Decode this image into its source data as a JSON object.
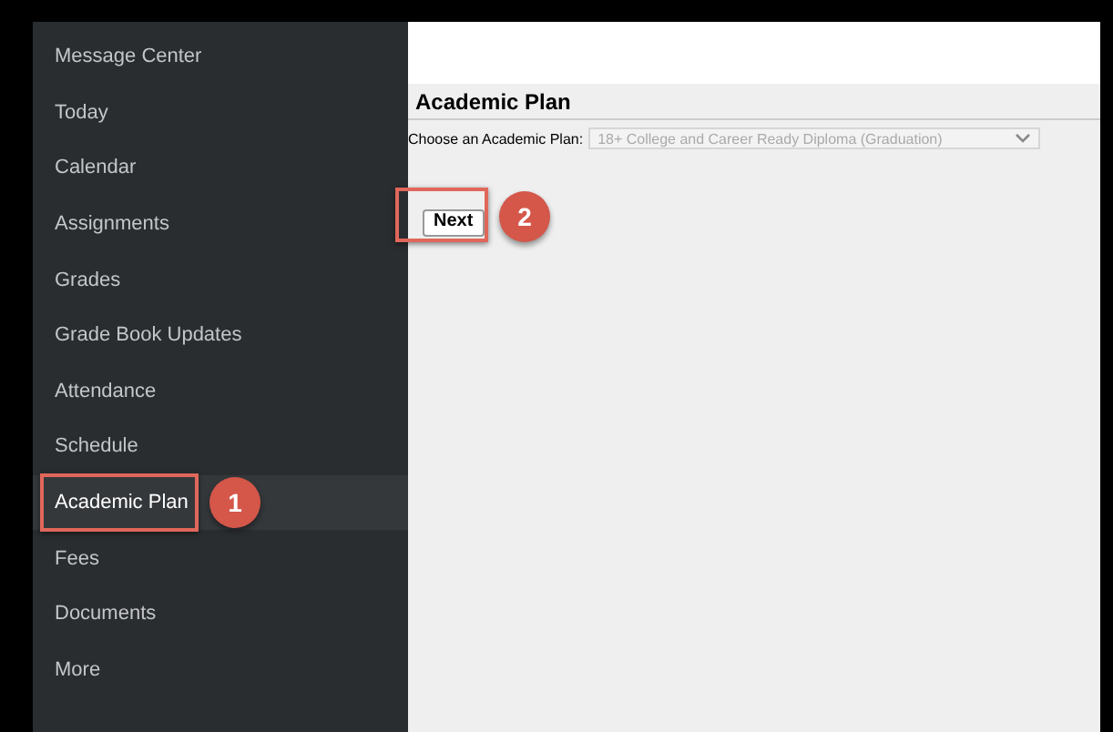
{
  "sidebar": {
    "items": [
      {
        "label": "Message Center",
        "selected": false
      },
      {
        "label": "Today",
        "selected": false
      },
      {
        "label": "Calendar",
        "selected": false
      },
      {
        "label": "Assignments",
        "selected": false
      },
      {
        "label": "Grades",
        "selected": false
      },
      {
        "label": "Grade Book Updates",
        "selected": false
      },
      {
        "label": "Attendance",
        "selected": false
      },
      {
        "label": "Schedule",
        "selected": false
      },
      {
        "label": "Academic Plan",
        "selected": true,
        "callout": "1"
      },
      {
        "label": "Fees",
        "selected": false
      },
      {
        "label": "Documents",
        "selected": false
      },
      {
        "label": "More",
        "selected": false
      }
    ]
  },
  "main": {
    "title": "Academic Plan",
    "plan_label": "Choose an Academic Plan:",
    "plan_select": {
      "value": "18+ College and Career Ready Diploma (Graduation)",
      "disabled": true
    },
    "next_button": {
      "label": "Next",
      "callout": "2"
    }
  }
}
